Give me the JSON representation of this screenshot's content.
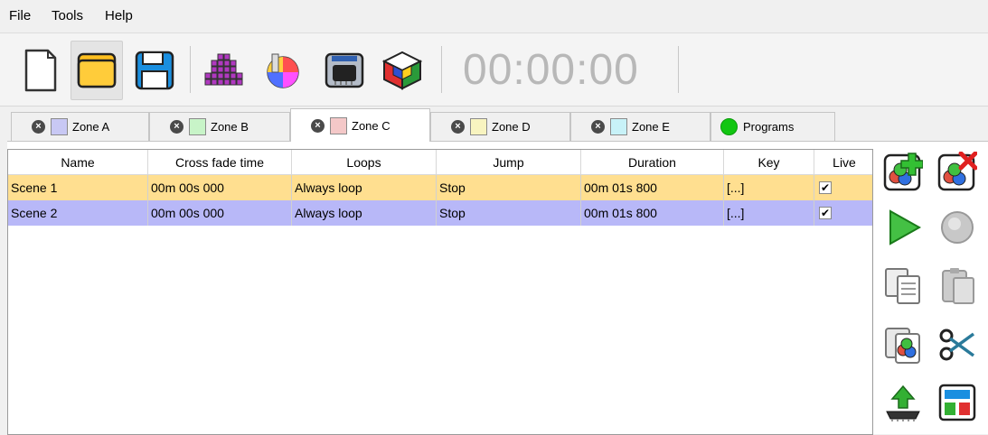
{
  "menu": {
    "items": [
      {
        "label": "File"
      },
      {
        "label": "Tools"
      },
      {
        "label": "Help"
      }
    ]
  },
  "toolbar": {
    "buttons": [
      {
        "icon": "new-document-icon"
      },
      {
        "icon": "open-folder-icon"
      },
      {
        "icon": "save-icon"
      },
      {
        "icon": "fixture-grid-icon"
      },
      {
        "icon": "color-wheel-icon"
      },
      {
        "icon": "interface-device-icon"
      },
      {
        "icon": "cube-icon"
      }
    ],
    "clock": "00:00:00"
  },
  "tabs": [
    {
      "label": "Zone A",
      "color": "#c8c8f4"
    },
    {
      "label": "Zone B",
      "color": "#c8f4c8"
    },
    {
      "label": "Zone C",
      "color": "#f4c8c8",
      "active": true
    },
    {
      "label": "Zone D",
      "color": "#f8f4c0"
    },
    {
      "label": "Zone E",
      "color": "#c8f2f8"
    },
    {
      "label": "Programs",
      "color": "#12c612"
    }
  ],
  "table": {
    "columns": [
      "Name",
      "Cross fade time",
      "Loops",
      "Jump",
      "Duration",
      "Key",
      "Live"
    ],
    "rows": [
      {
        "cells": [
          "Scene 1",
          "00m 00s 000",
          "Always loop",
          "Stop",
          "00m 01s 800",
          "[...]"
        ],
        "live": "✔",
        "color": "#ffdf90"
      },
      {
        "cells": [
          "Scene 2",
          "00m 00s 000",
          "Always loop",
          "Stop",
          "00m 01s 800",
          "[...]"
        ],
        "live": "✔",
        "color": "#b8b8f8"
      }
    ]
  },
  "side_buttons": [
    {
      "icon": "add-scene-icon"
    },
    {
      "icon": "delete-scene-icon"
    },
    {
      "icon": "play-icon"
    },
    {
      "icon": "stop-icon"
    },
    {
      "icon": "copy-icon"
    },
    {
      "icon": "paste-icon"
    },
    {
      "icon": "duplicate-scene-icon"
    },
    {
      "icon": "cut-icon"
    },
    {
      "icon": "upload-to-device-icon"
    },
    {
      "icon": "layout-icon"
    }
  ]
}
